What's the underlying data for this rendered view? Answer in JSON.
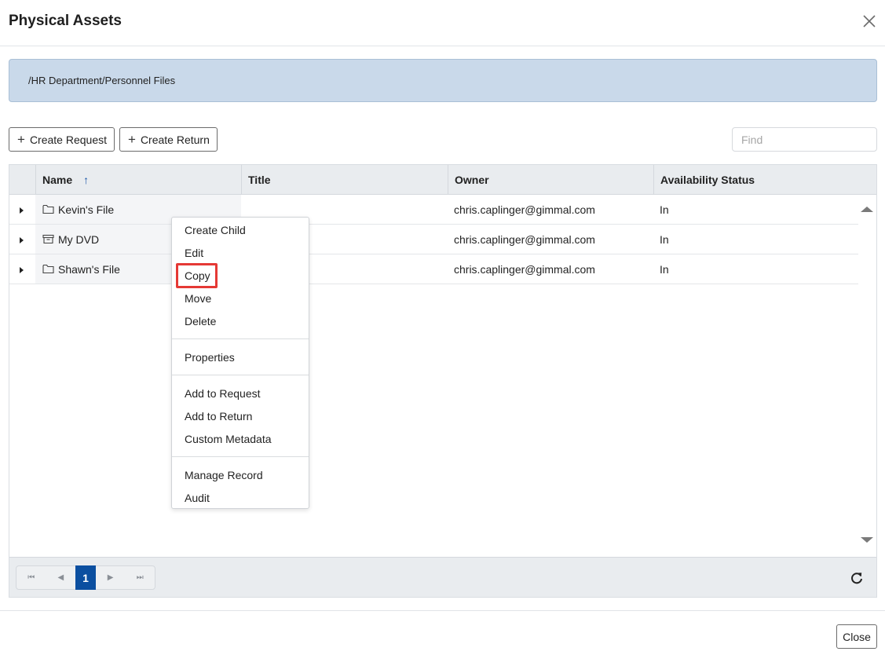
{
  "dialog": {
    "title": "Physical Assets",
    "close_icon": "close-icon"
  },
  "breadcrumb": {
    "path": "/HR Department/Personnel Files"
  },
  "toolbar": {
    "create_request": "Create Request",
    "create_return": "Create Return",
    "find_placeholder": "Find"
  },
  "grid": {
    "columns": [
      "Name",
      "Title",
      "Owner",
      "Availability Status"
    ],
    "sort_indicator": "↑",
    "rows": [
      {
        "name": "Kevin's File",
        "icon": "folder-icon",
        "title": "",
        "owner": "chris.caplinger@gimmal.com",
        "status": "In"
      },
      {
        "name": "My DVD",
        "icon": "box-icon",
        "title": "",
        "owner": "chris.caplinger@gimmal.com",
        "status": "In"
      },
      {
        "name": "Shawn's File",
        "icon": "folder-icon",
        "title": "",
        "owner": "chris.caplinger@gimmal.com",
        "status": "In"
      }
    ]
  },
  "context_menu": {
    "items": [
      "Create Child",
      "Edit",
      "Copy",
      "Move",
      "Delete",
      "Properties",
      "Add to Request",
      "Add to Return",
      "Custom Metadata",
      "Manage Record",
      "Audit"
    ],
    "highlighted": "Copy",
    "highlight_color": "#e53935"
  },
  "pager": {
    "current_page": "1",
    "first_glyph": "⏮",
    "prev_glyph": "◀",
    "next_glyph": "▶",
    "last_glyph": "⏭"
  },
  "footer": {
    "close_label": "Close"
  },
  "colors": {
    "accent": "#0b4fa0",
    "breadcrumb_bg": "#c9d9ea",
    "header_bg": "#e9ecef"
  }
}
